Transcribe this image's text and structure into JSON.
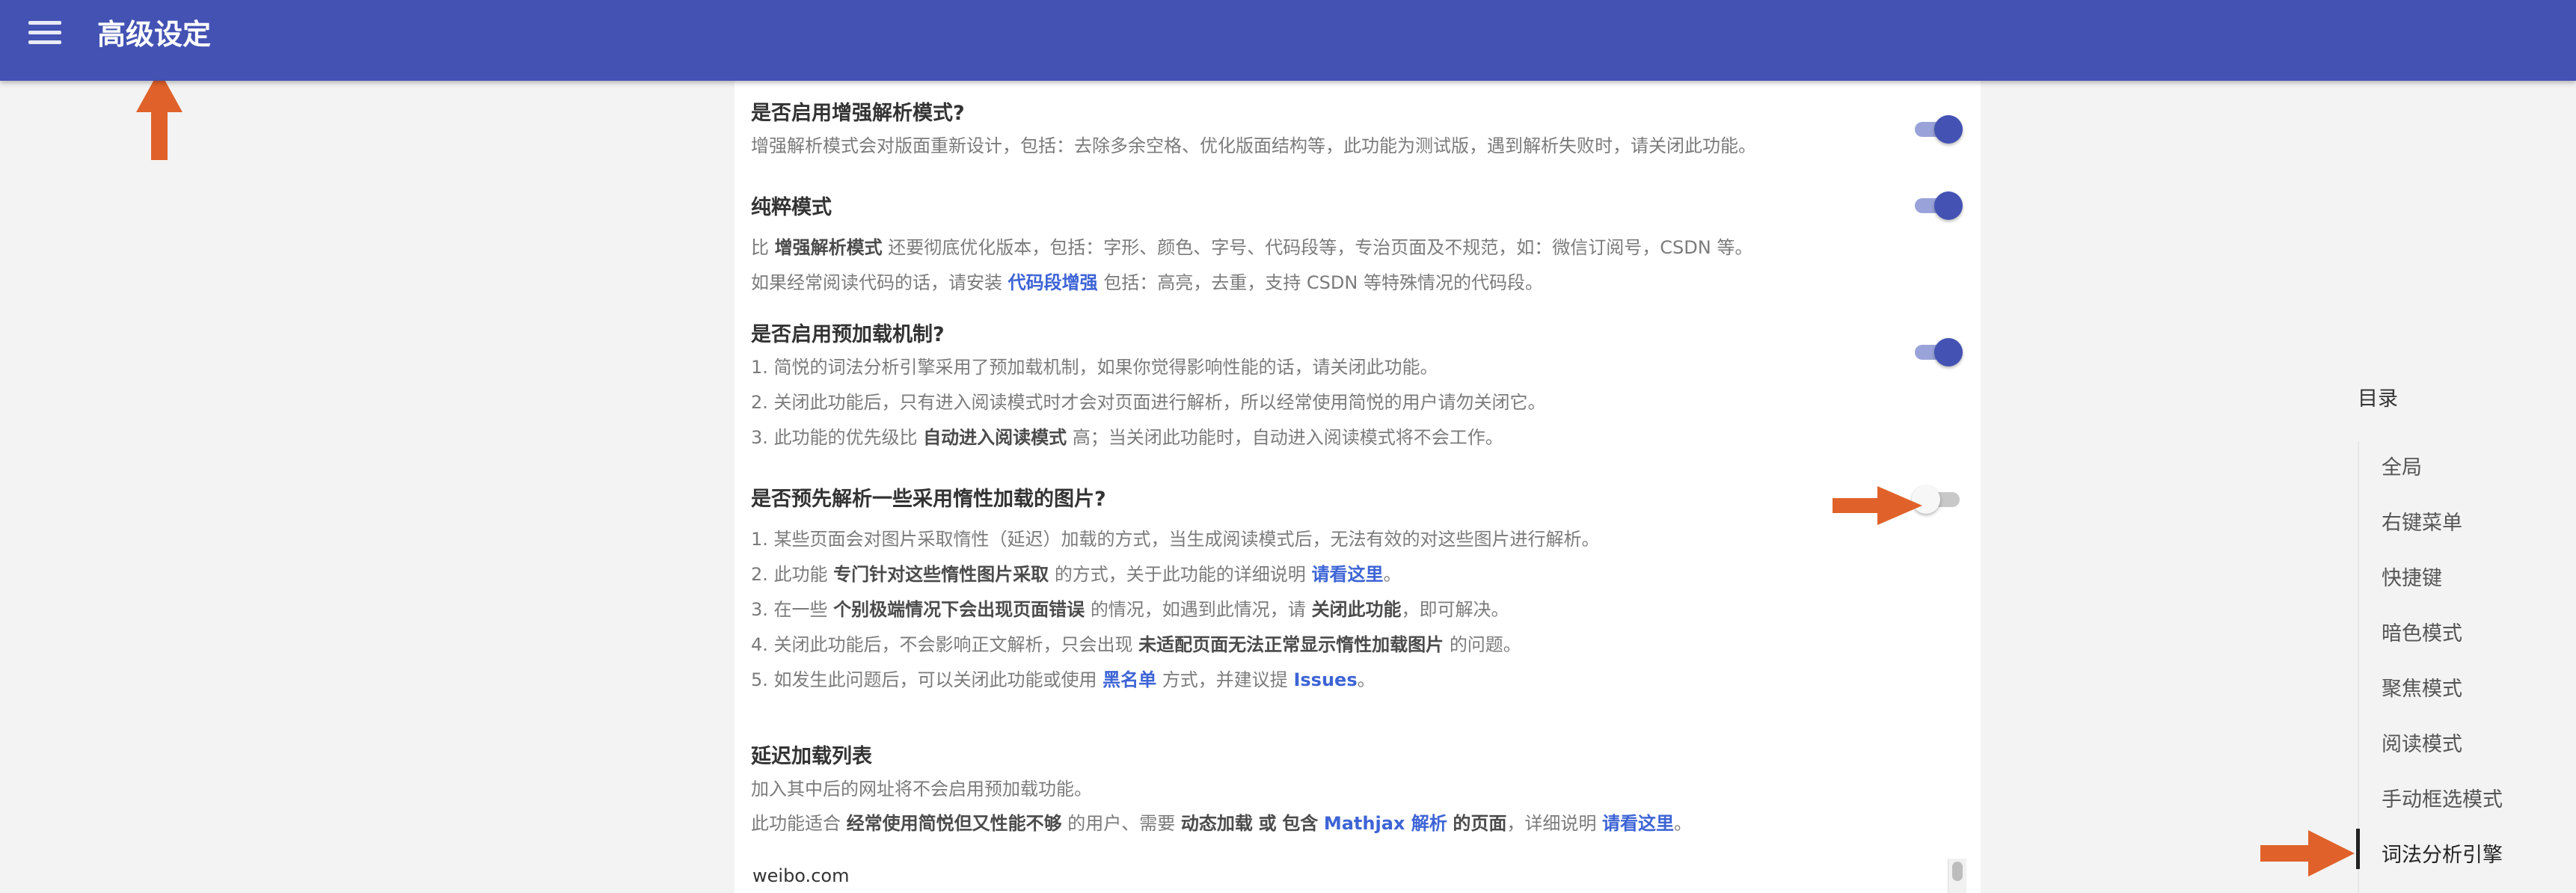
{
  "appbar": {
    "title": "高级设定",
    "menu_icon": "hamburger-menu-icon",
    "color": "#4352b3"
  },
  "settings": {
    "enhanced_parse": {
      "title": "是否启用增强解析模式?",
      "desc": "增强解析模式会对版面重新设计，包括：去除多余空格、优化版面结构等，此功能为测试版，遇到解析失败时，请关闭此功能。",
      "enabled": true
    },
    "pure_mode": {
      "title": "纯粹模式",
      "line1_a": "比",
      "line1_b": "增强解析模式",
      "line1_c": "还要彻底优化版本，包括：字形、颜色、字号、代码段等，专治页面及不规范，如：微信订阅号，CSDN 等。",
      "line2_a": "如果经常阅读代码的话，请安装",
      "line2_link": "代码段增强",
      "line2_c": "包括：高亮，去重，支持 CSDN 等特殊情况的代码段。",
      "enabled": true
    },
    "preload": {
      "title": "是否启用预加载机制?",
      "line1": "1. 简悦的词法分析引擎采用了预加载机制，如果你觉得影响性能的话，请关闭此功能。",
      "line2": "2. 关闭此功能后，只有进入阅读模式时才会对页面进行解析，所以经常使用简悦的用户请勿关闭它。",
      "line3_a": "3. 此功能的优先级比",
      "line3_b": "自动进入阅读模式",
      "line3_c": "高；当关闭此功能时，自动进入阅读模式将不会工作。",
      "enabled": true
    },
    "lazy_images": {
      "title": "是否预先解析一些采用惰性加载的图片?",
      "line1": "1. 某些页面会对图片采取惰性（延迟）加载的方式，当生成阅读模式后，无法有效的对这些图片进行解析。",
      "line2_a": "2. 此功能",
      "line2_b": "专门针对这些惰性图片采取",
      "line2_c": "的方式，关于此功能的详细说明",
      "line2_link": "请看这里",
      "line2_end": "。",
      "line3_a": "3. 在一些",
      "line3_b": "个别极端情况下会出现页面错误",
      "line3_c": "的情况，如遇到此情况，请",
      "line3_d": "关闭此功能",
      "line3_e": "，即可解决。",
      "line4_a": "4. 关闭此功能后，不会影响正文解析，只会出现",
      "line4_b": "未适配页面无法正常显示惰性加载图片",
      "line4_c": "的问题。",
      "line5_a": "5. 如发生此问题后，可以关闭此功能或使用",
      "line5_link1": "黑名单",
      "line5_c": "方式，并建议提",
      "line5_link2": "Issues",
      "line5_end": "。",
      "enabled": false
    },
    "delay_list": {
      "title": "延迟加载列表",
      "line1": "加入其中后的网址将不会启用预加载功能。",
      "line2_a": "此功能适合",
      "line2_b": "经常使用简悦但又性能不够",
      "line2_c": "的用户、需要",
      "line2_d": "动态加载",
      "line2_e": "或",
      "line2_f": "包含",
      "line2_link1": "Mathjax 解析",
      "line2_g": "的页面",
      "line2_h": "，详细说明",
      "line2_link2": "请看这里",
      "line2_end": "。",
      "value": "weibo.com"
    }
  },
  "toc": {
    "heading": "目录",
    "items": [
      "全局",
      "右键菜单",
      "快捷键",
      "暗色模式",
      "聚焦模式",
      "阅读模式",
      "手动框选模式",
      "词法分析引擎"
    ],
    "active": "词法分析引擎"
  },
  "colors": {
    "accent": "#4352b3",
    "link": "#3d64d6",
    "arrow": "#e0622a"
  }
}
